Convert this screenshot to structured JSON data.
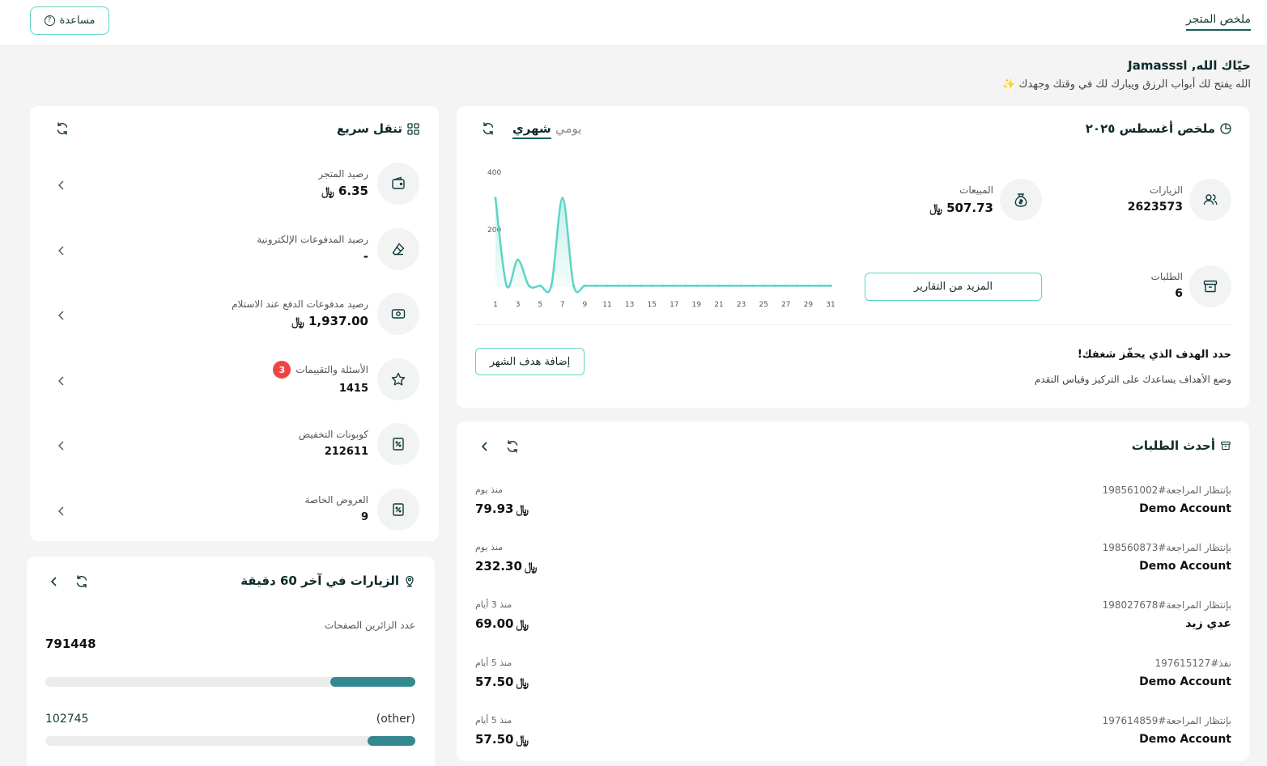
{
  "topbar": {
    "tab_store": "ملخص المتجر",
    "help_label": "مساعدة"
  },
  "greeting": {
    "title": "حيّاك الله, Jamasssl",
    "subtitle": "الله يفتح لك أبواب الرزق ويبارك لك في وقتك وجهدك",
    "sparkle": "✨"
  },
  "summary": {
    "title": "ملخص أغسطس ٢٠٢٥",
    "tab_monthly": "شهري",
    "tab_daily": "يومي",
    "visits_label": "الزيارات",
    "visits_value": "2623573",
    "sales_label": "المبيعات",
    "sales_value": "507.73",
    "orders_label": "الطلبات",
    "orders_value": "6",
    "more_reports": "المزيد من التقارير",
    "goal_title": "حدد الهدف الذي يحفّز شغفك!",
    "goal_sub": "وضع الأهداف يساعدك على التركيز وقياس التقدم",
    "add_goal": "إضافة هدف الشهر",
    "currency": "﷼"
  },
  "chart_data": {
    "type": "area",
    "x": [
      1,
      2,
      3,
      4,
      5,
      6,
      7,
      8,
      9,
      10,
      11,
      12,
      13,
      14,
      15,
      16,
      17,
      18,
      19,
      20,
      21,
      22,
      23,
      24,
      25,
      26,
      27,
      28,
      29,
      30,
      31
    ],
    "series": [
      {
        "values": [
          310,
          5,
          95,
          5,
          5,
          5,
          310,
          5,
          5,
          5,
          5,
          5,
          5,
          5,
          5,
          5,
          5,
          5,
          5,
          5,
          5,
          5,
          5,
          5,
          5,
          5,
          5,
          5,
          5,
          5,
          5
        ]
      }
    ],
    "x_ticks": [
      "1",
      "3",
      "5",
      "7",
      "9",
      "11",
      "13",
      "15",
      "17",
      "19",
      "21",
      "23",
      "25",
      "27",
      "29",
      "31"
    ],
    "y_ticks": [
      "400",
      "200"
    ],
    "ylim": [
      0,
      400
    ],
    "color": "#5dd5c4"
  },
  "quick_nav": {
    "title": "تنقل سريع",
    "items": [
      {
        "label": "رصيد المتجر",
        "value": "6.35",
        "currency": true
      },
      {
        "label": "رصيد المدفوعات الإلكترونية",
        "value": "-",
        "currency": false
      },
      {
        "label": "رصيد مدفوعات الدفع عند الاستلام",
        "value": "1,937.00",
        "currency": true
      },
      {
        "label": "الأسئلة والتقييمات",
        "value": "1415",
        "badge": "3",
        "currency": false
      },
      {
        "label": "كوبونات التخفيض",
        "value": "212611",
        "currency": false
      },
      {
        "label": "العروض الخاصة",
        "value": "9",
        "currency": false
      }
    ]
  },
  "orders": {
    "title": "أحدث الطلبات",
    "items": [
      {
        "status": "بإنتظار المراجعة#198561002",
        "name": "Demo Account",
        "time": "منذ يوم",
        "price": "79.93"
      },
      {
        "status": "بإنتظار المراجعة#198560873",
        "name": "Demo Account",
        "time": "منذ يوم",
        "price": "232.30"
      },
      {
        "status": "بإنتظار المراجعة#198027678",
        "name": "عدي زيد",
        "time": "منذ 3 أيام",
        "price": "69.00"
      },
      {
        "status": "نفذ#197615127",
        "name": "Demo Account",
        "time": "منذ 5 أيام",
        "price": "57.50"
      },
      {
        "status": "بإنتظار المراجعة#197614859",
        "name": "Demo Account",
        "time": "منذ 5 أيام",
        "price": "57.50"
      }
    ]
  },
  "visits60": {
    "title": "الزيارات في آخر 60 دقيقة",
    "header_label": "عدد الزائرين الصفحات",
    "total": "791448",
    "total_fraction": 0.23,
    "other_label": "(other)",
    "other_value": "102745",
    "other_fraction": 0.13
  },
  "colors": {
    "accent": "#5dd5c4",
    "dark": "#0f3b3b",
    "bar": "#33898f",
    "badge": "#ef4444"
  }
}
